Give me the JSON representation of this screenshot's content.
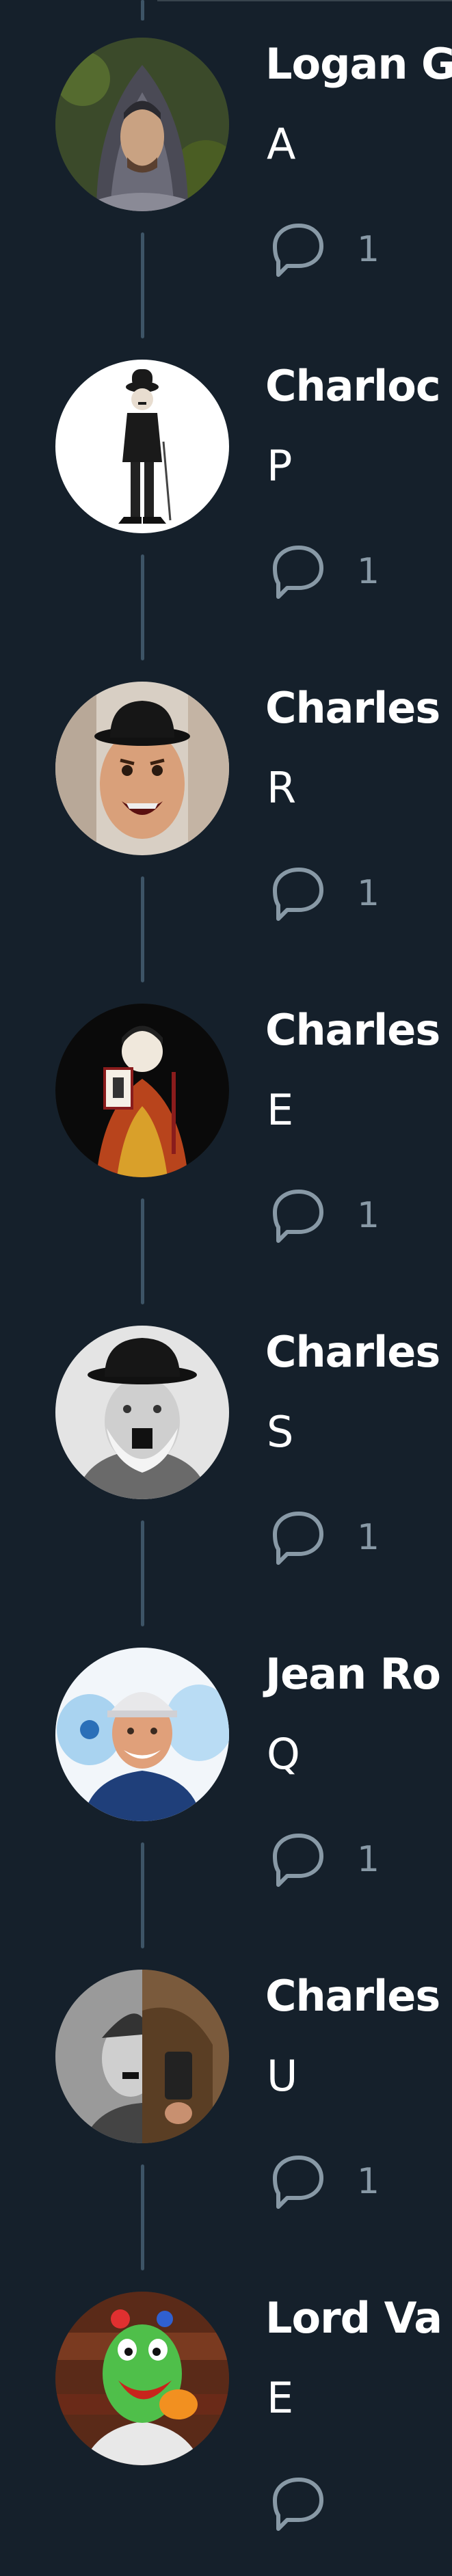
{
  "thread": {
    "tweets": [
      {
        "author": "Logan G",
        "text": "A",
        "reply_count": "1",
        "avatar_icon": "hooded-figure-avatar"
      },
      {
        "author": "Charloc",
        "text": "P",
        "reply_count": "1",
        "avatar_icon": "chaplin-tramp-avatar"
      },
      {
        "author": "Charles",
        "text": "R",
        "reply_count": "1",
        "avatar_icon": "bowler-hat-face-avatar"
      },
      {
        "author": "Charles",
        "text": "E",
        "reply_count": "1",
        "avatar_icon": "painted-figure-avatar"
      },
      {
        "author": "Charles",
        "text": "S",
        "reply_count": "1",
        "avatar_icon": "bowler-bearded-man-avatar"
      },
      {
        "author": "Jean Ro",
        "text": "Q",
        "reply_count": "1",
        "avatar_icon": "water-delivery-man-avatar"
      },
      {
        "author": "Charles",
        "text": "U",
        "reply_count": "1",
        "avatar_icon": "split-face-avatar"
      },
      {
        "author": "Lord Va",
        "text": "E",
        "reply_count": "",
        "avatar_icon": "cartoon-character-avatar"
      }
    ]
  },
  "colors": {
    "background": "#15202b",
    "thread_line": "#3d5466",
    "name": "#ffffff",
    "text": "#ffffff",
    "icon": "#8899a6"
  }
}
